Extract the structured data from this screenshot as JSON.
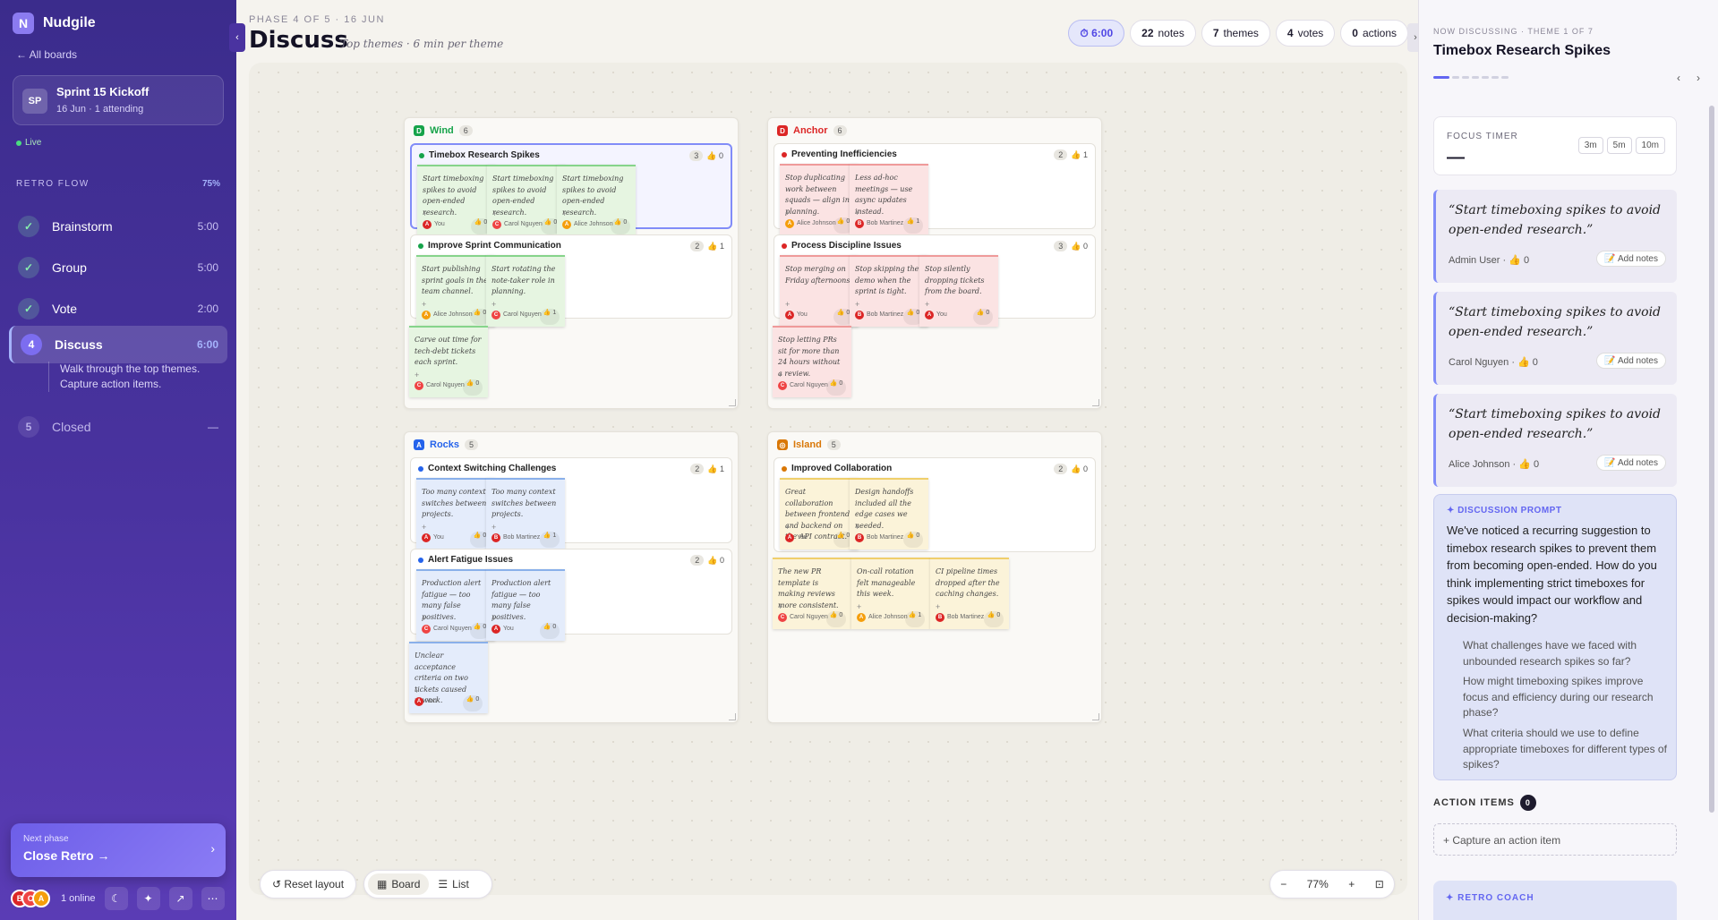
{
  "sidebar": {
    "logo_letter": "N",
    "app_name": "Nudgile",
    "all_boards": "← All boards",
    "board": {
      "avatar": "SP",
      "title": "Sprint 15 Kickoff",
      "subtitle": "16 Jun · 1 attending"
    },
    "live": "Live",
    "flow_label": "RETRO FLOW",
    "flow_progress": "75%",
    "phases": [
      {
        "icon": "✓",
        "label": "Brainstorm",
        "time": "5:00"
      },
      {
        "icon": "✓",
        "label": "Group",
        "time": "5:00"
      },
      {
        "icon": "✓",
        "label": "Vote",
        "time": "2:00"
      },
      {
        "icon": "4",
        "label": "Discuss",
        "time": "6:00"
      },
      {
        "icon": "5",
        "label": "Closed",
        "time": "—"
      }
    ],
    "phase_desc": "Walk through the top themes. Capture action items.",
    "next_phase_small": "Next phase",
    "next_phase_big": "Close Retro →",
    "next_chevron": "›",
    "avatars": [
      "B",
      "C",
      "A"
    ],
    "online": "1 online",
    "icons": [
      "☾",
      "✦",
      "↗",
      "⋯"
    ]
  },
  "header": {
    "phase_tag": "PHASE 4 OF 5 · 16 JUN",
    "title": "Discuss",
    "subtitle": "Top themes · 6 min per theme",
    "stats": [
      {
        "value": "⏱ 6:00",
        "label": ""
      },
      {
        "value": "22",
        "label": "notes"
      },
      {
        "value": "7",
        "label": "themes"
      },
      {
        "value": "4",
        "label": "votes"
      },
      {
        "value": "0",
        "label": "actions"
      }
    ]
  },
  "columns": [
    {
      "name": "Wind",
      "count": "6",
      "icon": "D",
      "color": "#16a34a",
      "themes": [
        {
          "title": "Timebox Research Spikes",
          "count": "3",
          "votes": "👍 0",
          "notes": [
            {
              "text": "Start timeboxing spikes to avoid open-ended research.",
              "author": "You",
              "initial": "A",
              "votes": "👍 0"
            },
            {
              "text": "Start timeboxing spikes to avoid open-ended research.",
              "author": "Carol Nguyen",
              "initial": "C",
              "votes": "👍 0"
            },
            {
              "text": "Start timeboxing spikes to avoid open-ended research.",
              "author": "Alice Johnson",
              "initial": "A",
              "votes": "👍 0"
            }
          ]
        },
        {
          "title": "Improve Sprint Communication",
          "count": "2",
          "votes": "👍 1",
          "notes": [
            {
              "text": "Start publishing sprint goals in the team channel.",
              "author": "Alice Johnson",
              "initial": "A",
              "votes": "👍 0"
            },
            {
              "text": "Start rotating the note-taker role in planning.",
              "author": "Carol Nguyen",
              "initial": "C",
              "votes": "👍 1"
            }
          ]
        }
      ],
      "loose": [
        {
          "text": "Carve out time for tech-debt tickets each sprint.",
          "author": "Carol Nguyen",
          "initial": "C",
          "votes": "👍 0"
        }
      ]
    },
    {
      "name": "Anchor",
      "count": "6",
      "icon": "D",
      "color": "#dc2626",
      "themes": [
        {
          "title": "Preventing Inefficiencies",
          "count": "2",
          "votes": "👍 1",
          "notes": [
            {
              "text": "Stop duplicating work between squads — align in planning.",
              "author": "Alice Johnson",
              "initial": "A",
              "votes": "👍 0"
            },
            {
              "text": "Less ad-hoc meetings — use async updates instead.",
              "author": "Bob Martinez",
              "initial": "B",
              "votes": "👍 1"
            }
          ]
        },
        {
          "title": "Process Discipline Issues",
          "count": "3",
          "votes": "👍 0",
          "notes": [
            {
              "text": "Stop merging on Friday afternoons.",
              "author": "You",
              "initial": "A",
              "votes": "👍 0"
            },
            {
              "text": "Stop skipping the demo when the sprint is tight.",
              "author": "Bob Martinez",
              "initial": "B",
              "votes": "👍 0"
            },
            {
              "text": "Stop silently dropping tickets from the board.",
              "author": "You",
              "initial": "A",
              "votes": "👍 0"
            }
          ]
        }
      ],
      "loose": [
        {
          "text": "Stop letting PRs sit for more than 24 hours without a review.",
          "author": "Carol Nguyen",
          "initial": "C",
          "votes": "👍 0"
        }
      ]
    },
    {
      "name": "Rocks",
      "count": "5",
      "icon": "A",
      "color": "#2563eb",
      "themes": [
        {
          "title": "Context Switching Challenges",
          "count": "2",
          "votes": "👍 1",
          "notes": [
            {
              "text": "Too many context switches between projects.",
              "author": "You",
              "initial": "A",
              "votes": "👍 0"
            },
            {
              "text": "Too many context switches between projects.",
              "author": "Bob Martinez",
              "initial": "B",
              "votes": "👍 1"
            }
          ]
        },
        {
          "title": "Alert Fatigue Issues",
          "count": "2",
          "votes": "👍 0",
          "notes": [
            {
              "text": "Production alert fatigue — too many false positives.",
              "author": "Carol Nguyen",
              "initial": "C",
              "votes": "👍 0"
            },
            {
              "text": "Production alert fatigue — too many false positives.",
              "author": "You",
              "initial": "A",
              "votes": "👍 0"
            }
          ]
        }
      ],
      "loose": [
        {
          "text": "Unclear acceptance criteria on two tickets caused rework.",
          "author": "You",
          "initial": "A",
          "votes": "👍 0"
        }
      ]
    },
    {
      "name": "Island",
      "count": "5",
      "icon": "◎",
      "color": "#d97706",
      "themes": [
        {
          "title": "Improved Collaboration",
          "count": "2",
          "votes": "👍 0",
          "notes": [
            {
              "text": "Great collaboration between frontend and backend on the API contract.",
              "author": "You",
              "initial": "A",
              "votes": "👍 0"
            },
            {
              "text": "Design handoffs included all the edge cases we needed.",
              "author": "Bob Martinez",
              "initial": "B",
              "votes": "👍 0"
            }
          ]
        }
      ],
      "loose": [
        {
          "text": "The new PR template is making reviews more consistent.",
          "author": "Carol Nguyen",
          "initial": "C",
          "votes": "👍 0"
        },
        {
          "text": "On-call rotation felt manageable this week.",
          "author": "Alice Johnson",
          "initial": "A",
          "votes": "👍 1"
        },
        {
          "text": "CI pipeline times dropped after the caching changes.",
          "author": "Bob Martinez",
          "initial": "B",
          "votes": "👍 0"
        }
      ]
    }
  ],
  "toolbar": {
    "reset": "↺ Reset layout",
    "board": "Board",
    "list": "List",
    "zoom_out": "−",
    "zoom": "77%",
    "zoom_in": "+",
    "fit": "⊡"
  },
  "panel": {
    "now_label": "NOW DISCUSSING · THEME 1 OF 7",
    "title": "Timebox Research Spikes",
    "nav_prev": "‹",
    "nav_next": "›",
    "timer_label": "FOCUS TIMER",
    "timer_value": "—",
    "timer_options": [
      "3m",
      "5m",
      "10m"
    ],
    "quotes": [
      {
        "text": "“Start timeboxing spikes to avoid open-ended research.”",
        "by": "Admin User · 👍 0"
      },
      {
        "text": "“Start timeboxing spikes to avoid open-ended research.”",
        "by": "Carol Nguyen · 👍 0"
      },
      {
        "text": "“Start timeboxing spikes to avoid open-ended research.”",
        "by": "Alice Johnson · 👍 0"
      }
    ],
    "add_notes": "📝 Add notes",
    "prompt_label": "✦ DISCUSSION PROMPT",
    "prompt_text": "We've noticed a recurring suggestion to timebox research spikes to prevent them from becoming open-ended. How do you think implementing strict timeboxes for spikes would impact our workflow and decision-making?",
    "prompt_questions": [
      "What challenges have we faced with unbounded research spikes so far?",
      "How might timeboxing spikes improve focus and efficiency during our research phase?",
      "What criteria should we use to define appropriate timeboxes for different types of spikes?"
    ],
    "actions_label": "ACTION ITEMS",
    "actions_count": "0",
    "action_placeholder": "+ Capture an action item",
    "coach_label": "✦ RETRO COACH"
  },
  "colors": {
    "accent": "#6366f1",
    "sidebar": "#4a33a0",
    "green": "#16a34a",
    "red": "#dc2626",
    "blue": "#2563eb",
    "amber": "#d97706",
    "av_you": "#dc2626",
    "av_alice": "#f59e0b",
    "av_carol": "#ef4444",
    "av_bob": "#dc2626"
  }
}
